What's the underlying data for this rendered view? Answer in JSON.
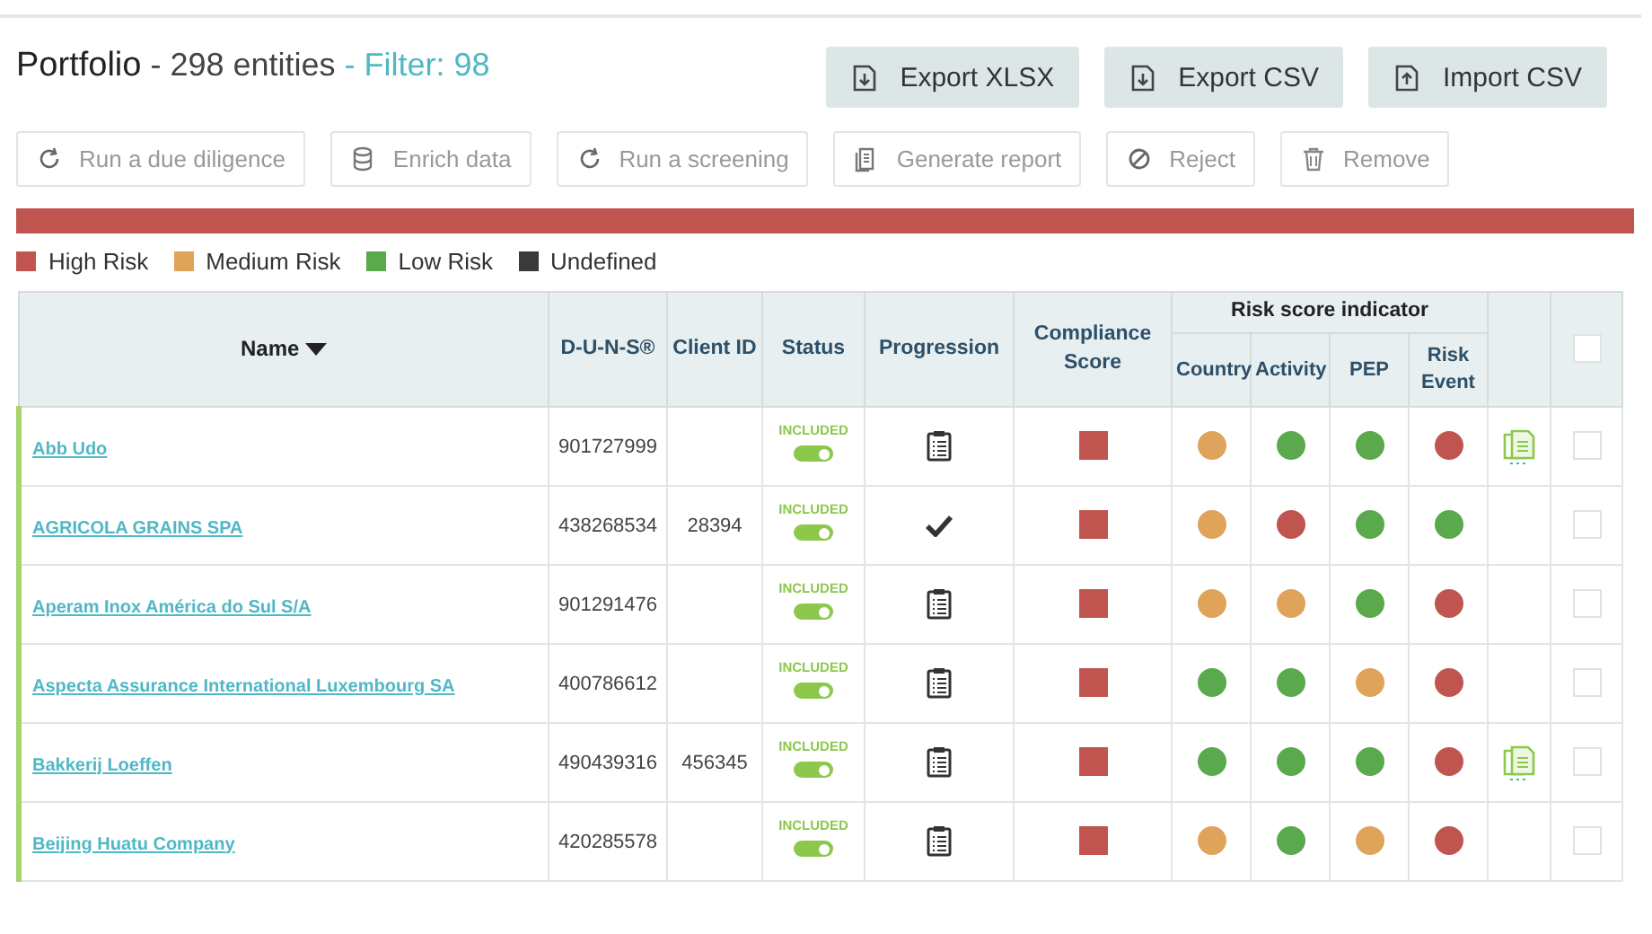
{
  "header": {
    "title": "Portfolio",
    "count": "- 298 entities",
    "filter": "- Filter: 98"
  },
  "export_buttons": [
    {
      "label": "Export XLSX",
      "kind": "download"
    },
    {
      "label": "Export CSV",
      "kind": "download"
    },
    {
      "label": "Import CSV",
      "kind": "upload"
    }
  ],
  "actions": [
    {
      "label": "Run a due diligence",
      "kind": "refresh"
    },
    {
      "label": "Enrich data",
      "kind": "database"
    },
    {
      "label": "Run a screening",
      "kind": "refresh"
    },
    {
      "label": "Generate report",
      "kind": "report"
    },
    {
      "label": "Reject",
      "kind": "block"
    },
    {
      "label": "Remove",
      "kind": "trash"
    }
  ],
  "risk_bar": {
    "level": 1
  },
  "legend": [
    {
      "label": "High Risk",
      "color": "#c0554f"
    },
    {
      "label": "Medium Risk",
      "color": "#e0a35a"
    },
    {
      "label": "Low Risk",
      "color": "#5aa94c"
    },
    {
      "label": "Undefined",
      "color": "#3a3a3a"
    }
  ],
  "table": {
    "columns": {
      "name": "Name",
      "duns": "D-U-N-S®",
      "client_id": "Client ID",
      "status": "Status",
      "progression": "Progression",
      "compliance": "Compliance Score",
      "risk_group": "Risk score indicator",
      "country": "Country",
      "activity": "Activity",
      "pep": "PEP",
      "risk_event": "Risk Event"
    },
    "select_all": {
      "checked": false
    },
    "rows": [
      {
        "name": "Abb Udo",
        "duns": "901727999",
        "status": "INCLUDED",
        "included": true,
        "completed": false,
        "compliance": {
          "color": "#c0554f"
        },
        "risks": [
          {
            "color": "#e0a35a"
          },
          {
            "color": "#5aa94c"
          },
          {
            "color": "#5aa94c"
          },
          {
            "color": "#c0554f"
          }
        ],
        "document": true,
        "checked": false
      },
      {
        "name": "AGRICOLA GRAINS SPA",
        "duns": "438268534",
        "client_id": "28394",
        "status": "INCLUDED",
        "included": true,
        "completed": true,
        "compliance": {
          "color": "#c0554f"
        },
        "risks": [
          {
            "color": "#e0a35a"
          },
          {
            "color": "#c0554f"
          },
          {
            "color": "#5aa94c"
          },
          {
            "color": "#5aa94c"
          }
        ],
        "document": false,
        "checked": false
      },
      {
        "name": "Aperam Inox América do Sul S/A",
        "duns": "901291476",
        "status": "INCLUDED",
        "included": true,
        "completed": false,
        "compliance": {
          "color": "#c0554f"
        },
        "risks": [
          {
            "color": "#e0a35a"
          },
          {
            "color": "#e0a35a"
          },
          {
            "color": "#5aa94c"
          },
          {
            "color": "#c0554f"
          }
        ],
        "document": false,
        "checked": false
      },
      {
        "name": "Aspecta Assurance International Luxembourg SA",
        "duns": "400786612",
        "status": "INCLUDED",
        "included": true,
        "completed": false,
        "compliance": {
          "color": "#c0554f"
        },
        "risks": [
          {
            "color": "#5aa94c"
          },
          {
            "color": "#5aa94c"
          },
          {
            "color": "#e0a35a"
          },
          {
            "color": "#c0554f"
          }
        ],
        "document": false,
        "checked": false
      },
      {
        "name": "Bakkerij Loeffen",
        "duns": "490439316",
        "client_id": "456345",
        "status": "INCLUDED",
        "included": true,
        "completed": false,
        "compliance": {
          "color": "#c0554f"
        },
        "risks": [
          {
            "color": "#5aa94c"
          },
          {
            "color": "#5aa94c"
          },
          {
            "color": "#5aa94c"
          },
          {
            "color": "#c0554f"
          }
        ],
        "document": true,
        "checked": false
      },
      {
        "name": "Beijing Huatu Company",
        "duns": "420285578",
        "status": "INCLUDED",
        "included": true,
        "completed": false,
        "compliance": {
          "color": "#c0554f"
        },
        "risks": [
          {
            "color": "#e0a35a"
          },
          {
            "color": "#5aa94c"
          },
          {
            "color": "#e0a35a"
          },
          {
            "color": "#c0554f"
          }
        ],
        "document": false,
        "checked": false
      }
    ]
  }
}
